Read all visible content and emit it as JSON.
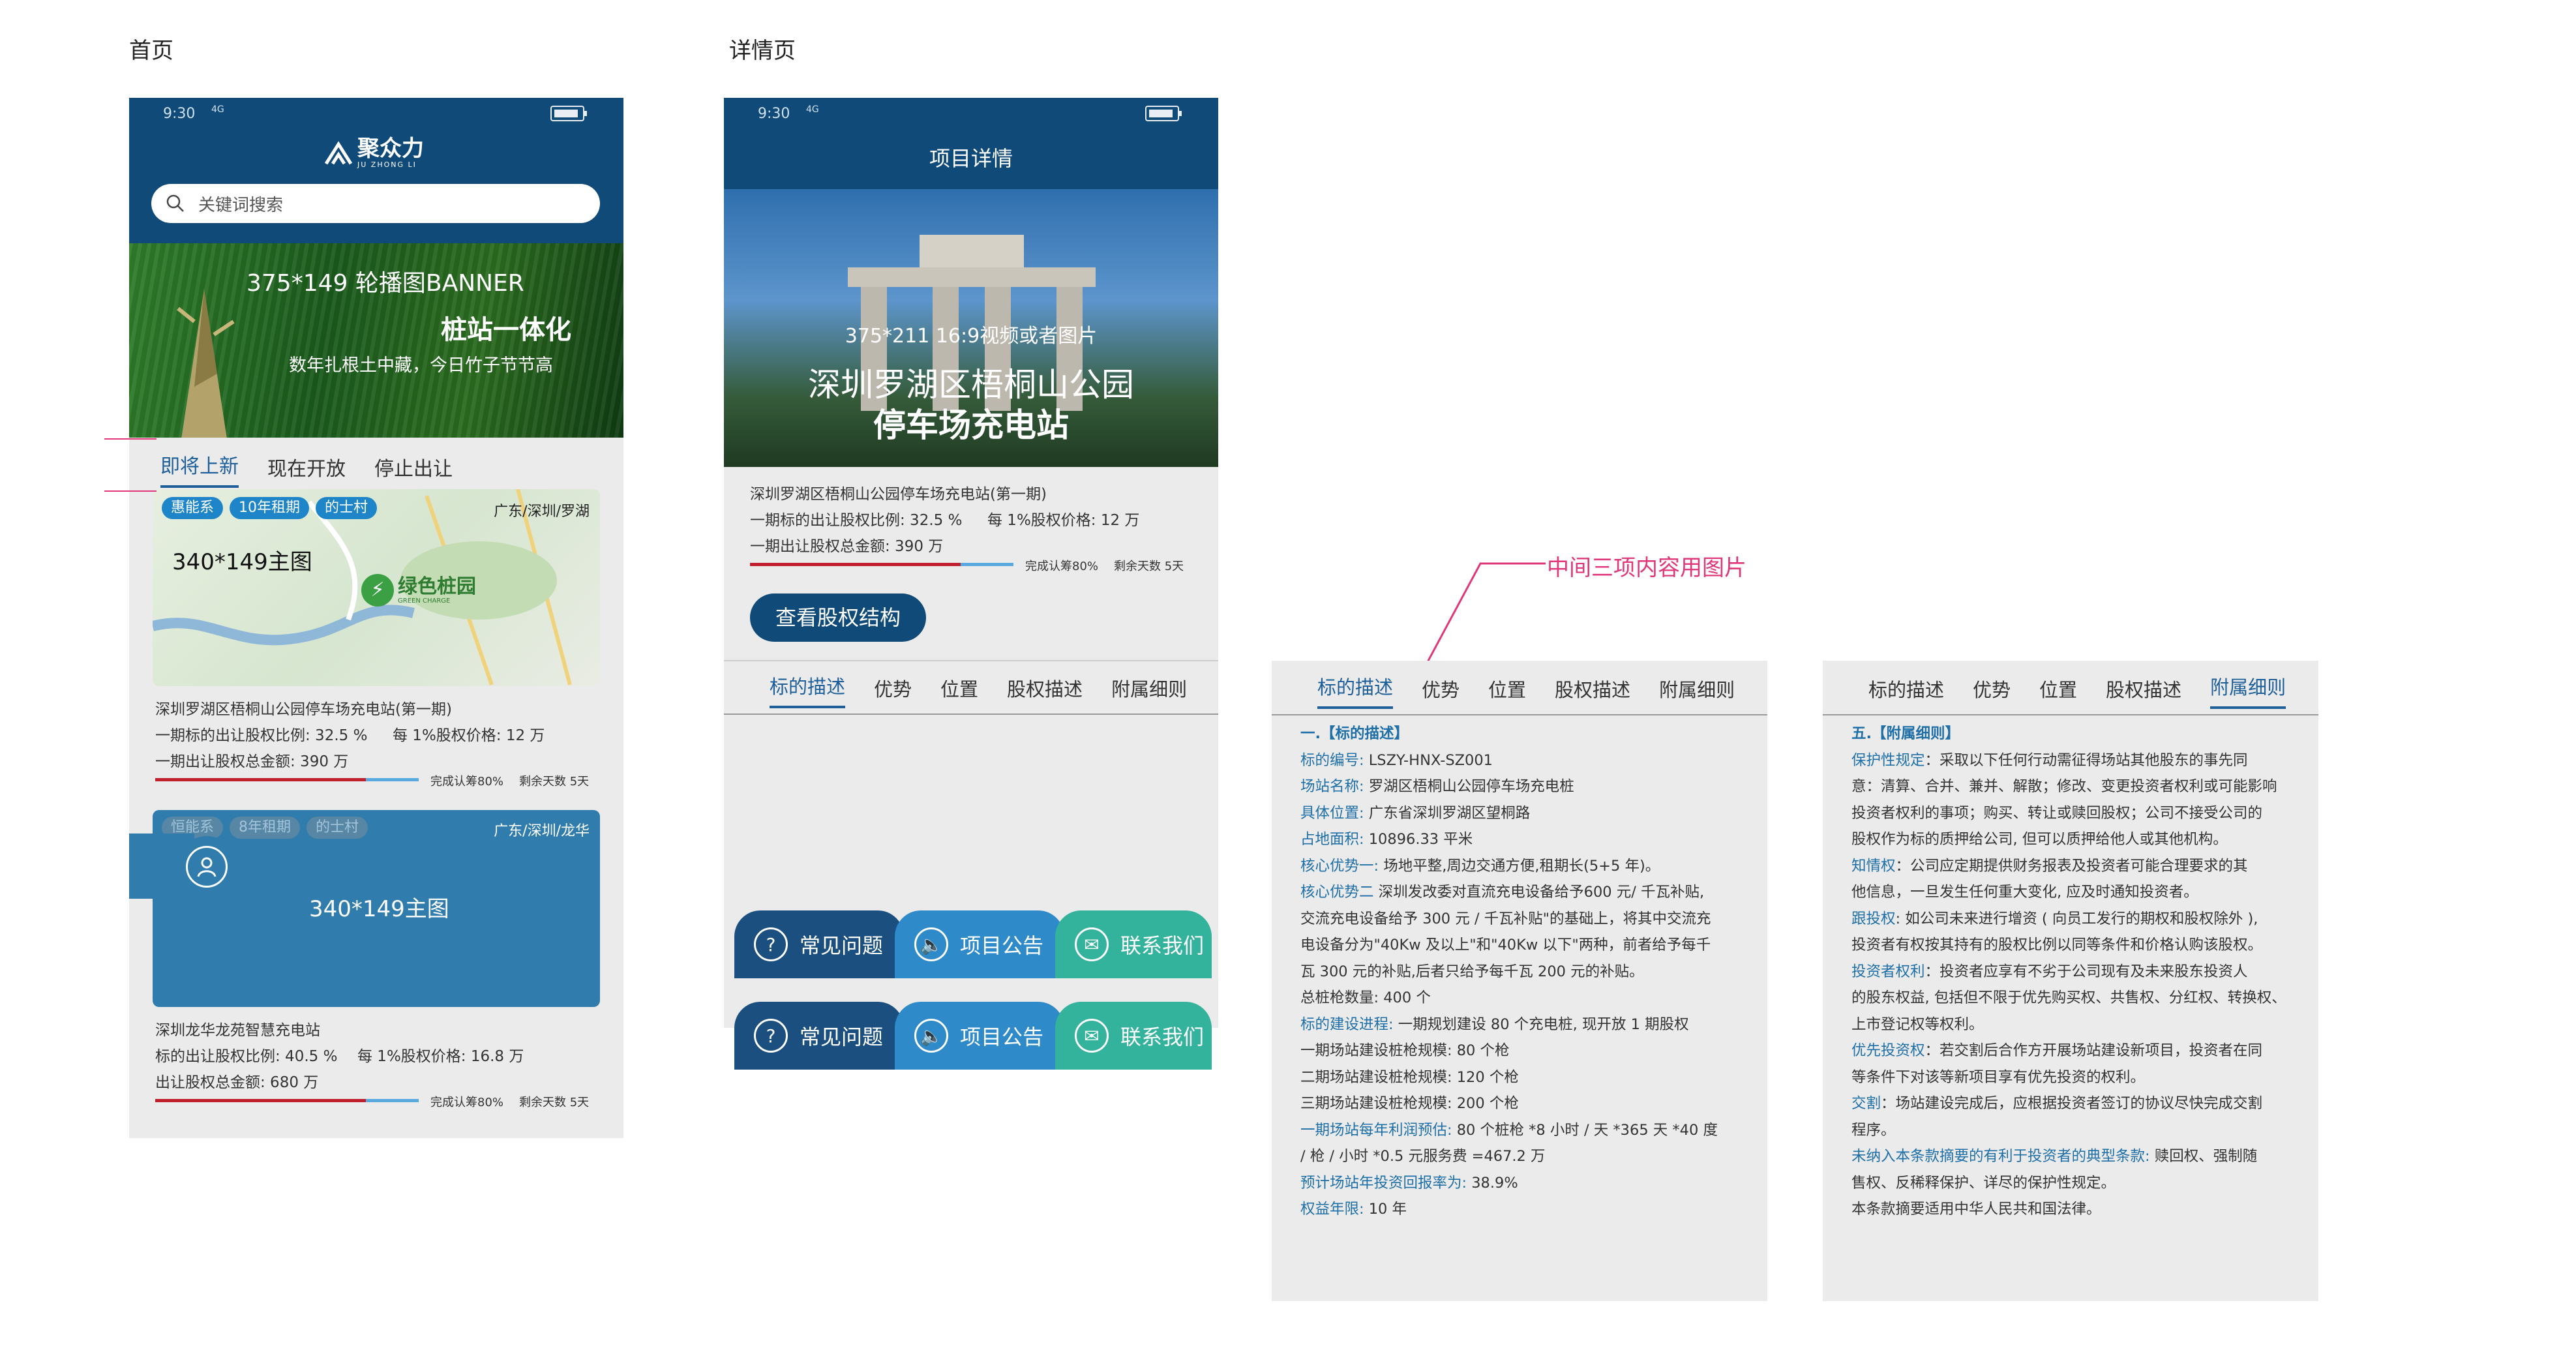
{
  "labels": {
    "home": "首页",
    "detail": "详情页",
    "annotation": "中间三项内容用图片"
  },
  "status": {
    "time": "9:30",
    "signal": "4G"
  },
  "home": {
    "logo_cn": "聚众力",
    "logo_en": "JU ZHONG LI",
    "search_placeholder": "关键词搜索",
    "banner": {
      "title": "375*149 轮播图BANNER",
      "brand": "桩站一体化",
      "slogan": "数年扎根土中藏，今日竹子节节高"
    },
    "tabs": [
      "即将上新",
      "现在开放",
      "停止出让"
    ],
    "card1": {
      "tags": [
        "惠能系",
        "10年租期",
        "的士村"
      ],
      "region": "广东/深圳/罗湖",
      "img_label": "340*149主图",
      "logo_cn": "绿色桩园",
      "logo_en": "GREEN CHARGE",
      "name": "深圳罗湖区梧桐山公园停车场充电站(第一期)",
      "line2a": "一期标的出让股权比例: 32.5 %",
      "line2b": "每 1%股权价格: 12 万",
      "line3": "一期出让股权总金额: 390  万",
      "progress": 0.8,
      "progress_label": "完成认筹80%",
      "remain": "剩余天数  5天"
    },
    "card2": {
      "tags": [
        "恒能系",
        "8年租期",
        "的士村"
      ],
      "region": "广东/深圳/龙华",
      "img_label": "340*149主图",
      "name": "深圳龙华龙苑智慧充电站",
      "line2a": "标的出让股权比例: 40.5 %",
      "line2b": "每 1%股权价格: 16.8 万",
      "line3": "出让股权总金额: 680  万",
      "progress": 0.8,
      "progress_label": "完成认筹80%",
      "remain": "剩余天数  5天"
    }
  },
  "detail": {
    "title": "项目详情",
    "hero": {
      "note": "375*211 16:9视频或者图片",
      "line1": "深圳罗湖区梧桐山公园",
      "line2": "停车场充电站"
    },
    "name": "深圳罗湖区梧桐山公园停车场充电站(第一期)",
    "line2a": "一期标的出让股权比例: 32.5 %",
    "line2b": "每 1%股权价格: 12 万",
    "line3": "一期出让股权总金额: 390  万",
    "progress": 0.8,
    "progress_label": "完成认筹80%",
    "remain": "剩余天数  5天",
    "equity_button": "查看股权结构",
    "tabs": [
      "标的描述",
      "优势",
      "位置",
      "股权描述",
      "附属细则"
    ],
    "buttons": [
      "常见问题",
      "项目公告",
      "联系我们"
    ],
    "button_colors": [
      "#1b4f7f",
      "#2e8ac8",
      "#34b39c"
    ]
  },
  "panel1": {
    "tabs": [
      "标的描述",
      "优势",
      "位置",
      "股权描述",
      "附属细则"
    ],
    "heading": "一.【标的描述】",
    "rows": [
      {
        "k": "标的编号:",
        "v": " LSZY-HNX-SZ001"
      },
      {
        "k": "场站名称:",
        "v": " 罗湖区梧桐山公园停车场充电桩"
      },
      {
        "k": "具体位置:",
        "v": " 广东省深圳罗湖区望桐路"
      },
      {
        "k": "占地面积:",
        "v": " 10896.33 平米"
      },
      {
        "k": "核心优势一:",
        "v": " 场地平整,周边交通方便,租期长(5+5 年)。"
      },
      {
        "k": "核心优势二",
        "v": " 深圳发改委对直流充电设备给予600 元/ 千瓦补贴,"
      },
      {
        "k": "",
        "v": "交流充电设备给予 300 元 / 千瓦补贴\"的基础上，将其中交流充"
      },
      {
        "k": "",
        "v": "电设备分为\"40Kw 及以上\"和\"40Kw 以下\"两种，前者给予每千"
      },
      {
        "k": "",
        "v": "瓦 300 元的补贴,后者只给予每千瓦 200 元的补贴。"
      },
      {
        "k": "",
        "v": "总桩枪数量:  400 个"
      },
      {
        "k": "标的建设进程:",
        "v": " 一期规划建设 80 个充电桩, 现开放 1 期股权"
      },
      {
        "k": "",
        "v": "一期场站建设桩枪规模:  80 个枪"
      },
      {
        "k": "",
        "v": "二期场站建设桩枪规模:  120 个枪"
      },
      {
        "k": "",
        "v": "三期场站建设桩枪规模:  200 个枪"
      },
      {
        "k": "一期场站每年利润预估:",
        "v": " 80 个桩枪 *8 小时 / 天 *365 天 *40 度"
      },
      {
        "k": "",
        "v": "/ 枪 / 小时 *0.5 元服务费 =467.2 万"
      },
      {
        "k": "预计场站年投资回报率为:",
        "v": " 38.9%"
      },
      {
        "k": "权益年限:",
        "v": " 10 年"
      }
    ]
  },
  "panel2": {
    "tabs": [
      "标的描述",
      "优势",
      "位置",
      "股权描述",
      "附属细则"
    ],
    "heading": "五.【附属细则】",
    "rows": [
      {
        "k": "保护性规定",
        "v": "：采取以下任何行动需征得场站其他股东的事先同"
      },
      {
        "k": "",
        "v": "意：清算、合并、兼并、解散；修改、变更投资者权利或可能影响"
      },
      {
        "k": "",
        "v": "投资者权利的事项；购买、转让或赎回股权；公司不接受公司的"
      },
      {
        "k": "",
        "v": "股权作为标的质押给公司, 但可以质押给他人或其他机构。"
      },
      {
        "k": "知情权",
        "v": "：公司应定期提供财务报表及投资者可能合理要求的其"
      },
      {
        "k": "",
        "v": "他信息，一旦发生任何重大变化, 应及时通知投资者。"
      },
      {
        "k": "跟投权",
        "v": ": 如公司未来进行增资 ( 向员工发行的期权和股权除外 ),"
      },
      {
        "k": "",
        "v": "投资者有权按其持有的股权比例以同等条件和价格认购该股权。"
      },
      {
        "k": "投资者权利",
        "v": "：投资者应享有不劣于公司现有及未来股东投资人"
      },
      {
        "k": "",
        "v": "的股东权益, 包括但不限于优先购买权、共售权、分红权、转换权、"
      },
      {
        "k": "",
        "v": "上市登记权等权利。"
      },
      {
        "k": "优先投资权",
        "v": "：若交割后合作方开展场站建设新项目，投资者在同"
      },
      {
        "k": "",
        "v": "等条件下对该等新项目享有优先投资的权利。"
      },
      {
        "k": "交割",
        "v": "：场站建设完成后，应根据投资者签订的协议尽快完成交割"
      },
      {
        "k": "",
        "v": "程序。"
      },
      {
        "k": "未纳入本条款摘要的有利于投资者的典型条款:",
        "v": " 赎回权、强制随"
      },
      {
        "k": "",
        "v": "售权、反稀释保护、详尽的保护性规定。"
      },
      {
        "k": "",
        "v": "本条款摘要适用中华人民共和国法律。"
      }
    ]
  }
}
